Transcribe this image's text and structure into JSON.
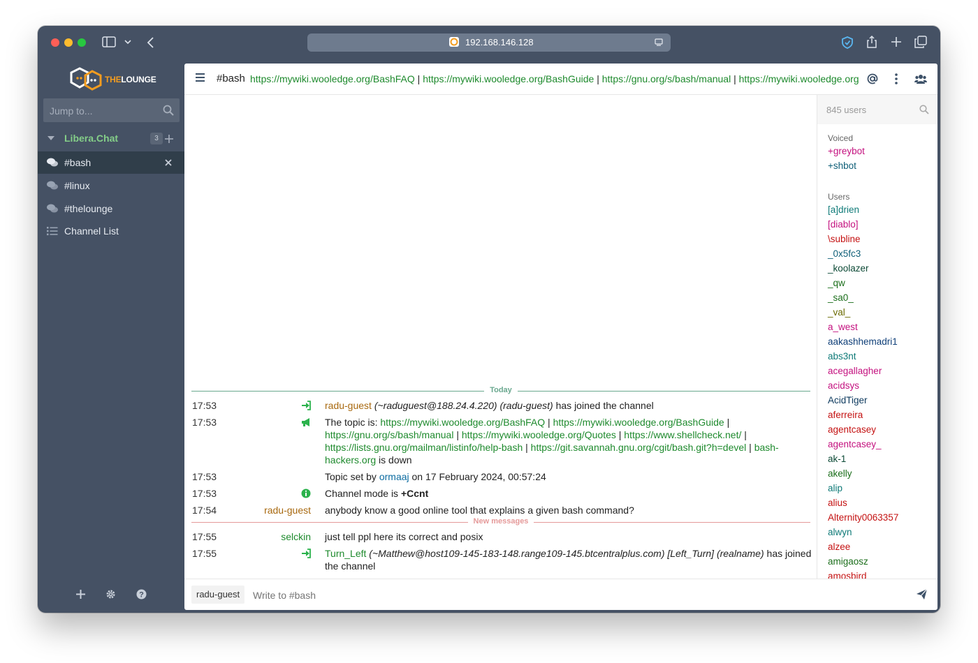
{
  "browser": {
    "url": "192.168.146.128"
  },
  "sidebar": {
    "logo_text": "THELOUNGE",
    "jump_placeholder": "Jump to...",
    "network": {
      "name": "Libera.Chat",
      "badge": "3"
    },
    "channels": [
      {
        "label": "#bash",
        "active": true
      },
      {
        "label": "#linux",
        "active": false
      },
      {
        "label": "#thelounge",
        "active": false
      },
      {
        "label": "Channel List",
        "active": false
      }
    ]
  },
  "header": {
    "channel": "#bash",
    "topic_links": [
      "https://mywiki.wooledge.org/BashFAQ",
      "https://mywiki.wooledge.org/BashGuide",
      "https://gnu.org/s/bash/manual",
      "https://mywiki.wooledge.org/"
    ],
    "separator": "|"
  },
  "chat": {
    "today_label": "Today",
    "new_messages_label": "New messages",
    "messages": {
      "join1": {
        "time": "17:53",
        "nick": "radu-guest",
        "host": "(~raduguest@188.24.4.220)",
        "realname": "(radu-guest)",
        "text": "has joined the channel"
      },
      "topic": {
        "time": "17:53",
        "prefix": "The topic is:",
        "links": [
          "https://mywiki.wooledge.org/BashFAQ",
          "https://mywiki.wooledge.org/BashGuide",
          "https://gnu.org/s/bash/manual",
          "https://mywiki.wooledge.org/Quotes",
          "https://www.shellcheck.net/",
          "https://lists.gnu.org/mailman/listinfo/help-bash",
          "https://git.savannah.gnu.org/cgit/bash.git?h=devel",
          "bash-hackers.org"
        ],
        "suffix": "is down"
      },
      "topic_set": {
        "time": "17:53",
        "prefix": "Topic set by",
        "nick": "ormaaj",
        "suffix": "on 17 February 2024, 00:57:24"
      },
      "mode": {
        "time": "17:53",
        "prefix": "Channel mode is",
        "mode": "+Ccnt"
      },
      "msg1": {
        "time": "17:54",
        "nick": "radu-guest",
        "text": "anybody know a good online tool that explains a given bash command?"
      },
      "msg2": {
        "time": "17:55",
        "nick": "selckin",
        "text": "just tell ppl here its correct and posix"
      },
      "join2": {
        "time": "17:55",
        "nick": "Turn_Left",
        "host": "(~Matthew@host109-145-183-148.range109-145.btcentralplus.com)",
        "account": "[Left_Turn]",
        "realname": "(realname)",
        "text": "has joined the channel"
      }
    }
  },
  "userlist": {
    "search_placeholder": "845 users",
    "voiced_label": "Voiced",
    "voiced": [
      {
        "name": "+greybot",
        "color": "#c4117f"
      },
      {
        "name": "+shbot",
        "color": "#0f5f78"
      }
    ],
    "users_label": "Users",
    "users": [
      {
        "name": "[a]drien",
        "color": "#0f7a78"
      },
      {
        "name": "[diablo]",
        "color": "#c4117f"
      },
      {
        "name": "\\subline",
        "color": "#c41212"
      },
      {
        "name": "_0x5fc3",
        "color": "#0f5f78"
      },
      {
        "name": "_koolazer",
        "color": "#0d4a36"
      },
      {
        "name": "_qw",
        "color": "#1b6e1b"
      },
      {
        "name": "_sa0_",
        "color": "#1b6e1b"
      },
      {
        "name": "_val_",
        "color": "#6a6a00"
      },
      {
        "name": "a_west",
        "color": "#c4117f"
      },
      {
        "name": "aakashhemadri1",
        "color": "#0f3f78"
      },
      {
        "name": "abs3nt",
        "color": "#0f7a78"
      },
      {
        "name": "acegallagher",
        "color": "#c4117f"
      },
      {
        "name": "acidsys",
        "color": "#c4117f"
      },
      {
        "name": "AcidTiger",
        "color": "#0d3a5e"
      },
      {
        "name": "aferreira",
        "color": "#c41212"
      },
      {
        "name": "agentcasey",
        "color": "#c41212"
      },
      {
        "name": "agentcasey_",
        "color": "#c4117f"
      },
      {
        "name": "ak-1",
        "color": "#0d4a36"
      },
      {
        "name": "akelly",
        "color": "#1b6e1b"
      },
      {
        "name": "alip",
        "color": "#0f7a78"
      },
      {
        "name": "alius",
        "color": "#c41212"
      },
      {
        "name": "Alternity0063357",
        "color": "#c41212"
      },
      {
        "name": "alwyn",
        "color": "#0f7a78"
      },
      {
        "name": "alzee",
        "color": "#c41212"
      },
      {
        "name": "amigaosz",
        "color": "#1b6e1b"
      },
      {
        "name": "amosbird",
        "color": "#c41212"
      }
    ]
  },
  "composer": {
    "nick": "radu-guest",
    "placeholder": "Write to #bash"
  },
  "colors": {
    "sidebar_bg": "#455164",
    "active_channel_bg": "#303e4a",
    "network_color": "#84ce88",
    "link_color": "#1e8a2d",
    "today_divider": "#6aa88f",
    "new_messages_divider": "#e59a9a"
  }
}
